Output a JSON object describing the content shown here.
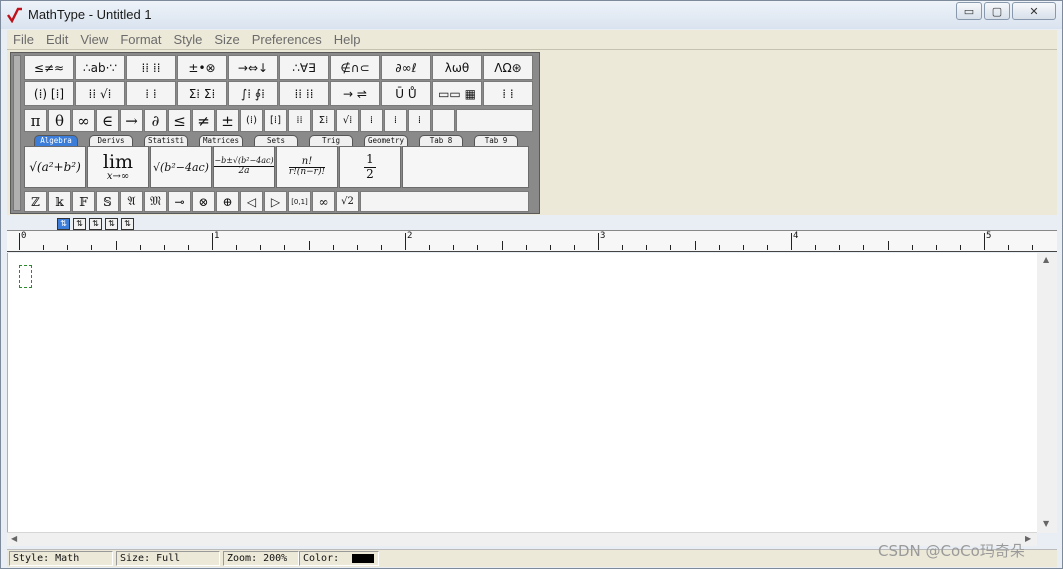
{
  "window": {
    "title": "MathType - Untitled 1",
    "controls": {
      "minimize": "▭",
      "maximize": "▢",
      "close": "✕"
    }
  },
  "menu": [
    "File",
    "Edit",
    "View",
    "Format",
    "Style",
    "Size",
    "Preferences",
    "Help"
  ],
  "palette_bar": [
    "≤≠≈",
    "∴ab·∵",
    "⁞⁞ ⁞⁞",
    "±•⊗",
    "→⇔↓",
    "∴∀∃",
    "∉∩⊂",
    "∂∞ℓ",
    "λωθ",
    "ΛΩ⊛"
  ],
  "template_bar": [
    "(⁞) [⁞]",
    "⁞⁞ √⁞",
    "⁞ ⁞",
    "Σ⁞ Σ⁞",
    "∫⁞ ∮⁞",
    "⁞⁞ ⁞⁞",
    "→ ⇌",
    "Ū Ů",
    "▭▭ ▦",
    "⁞ ⁞"
  ],
  "symbol_row": [
    "π",
    "θ",
    "∞",
    "∈",
    "→",
    "∂",
    "≤",
    "≠",
    "±",
    "(⁞)",
    "[⁞]",
    "⁞⁞",
    "Σ⁞",
    "√⁞",
    "⁞",
    "⁞",
    "⁞"
  ],
  "tabs": [
    "Algebra",
    "Derivs",
    "Statisti",
    "Matrices",
    "Sets",
    "Trig",
    "Geometry",
    "Tab 8",
    "Tab 9"
  ],
  "algebra_templates": [
    "√(a²+b²)",
    "lim",
    "x→∞",
    "√(b²−4ac)",
    "−b±√(b²−4ac)",
    "2a",
    "n!",
    "r!(n−r)!",
    "1",
    "2"
  ],
  "small_row": [
    "ℤ",
    "𝕜",
    "𝔽",
    "𝕊",
    "𝔄",
    "𝔐",
    "⊸",
    "⊗",
    "⊕",
    "◁",
    "▷",
    "[0,1]",
    "∞",
    "√2"
  ],
  "size_buttons": [
    "⇅",
    "⇅",
    "⇅",
    "⇅",
    "⇅"
  ],
  "ruler_labels": [
    "0",
    "1",
    "2",
    "3",
    "4",
    "5"
  ],
  "status": {
    "style": "Style: Math",
    "size": "Size: Full",
    "zoom": "Zoom: 200%",
    "color_label": "Color:",
    "color_value": "#000000"
  },
  "watermark": "CSDN @CoCo玛奇朵"
}
